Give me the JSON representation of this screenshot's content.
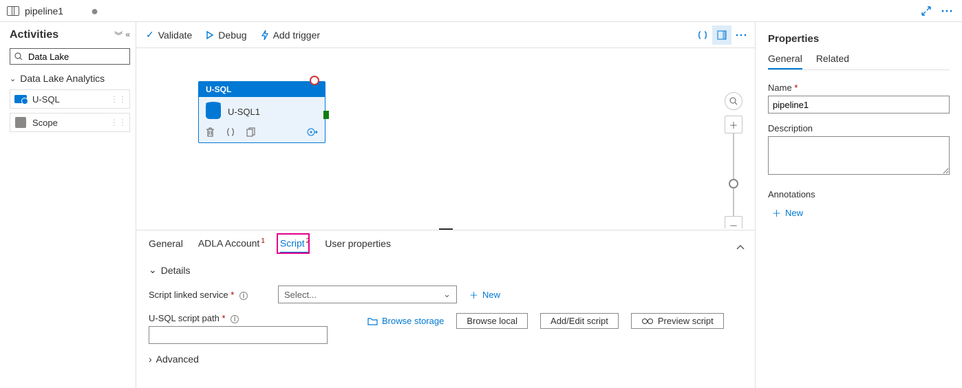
{
  "topbar": {
    "file_title": "pipeline1",
    "dirty": "●"
  },
  "sidebar": {
    "title": "Activities",
    "search_value": "Data Lake",
    "category": "Data Lake Analytics",
    "items": [
      {
        "label": "U-SQL"
      },
      {
        "label": "Scope"
      }
    ]
  },
  "toolbar": {
    "validate": "Validate",
    "debug": "Debug",
    "add_trigger": "Add trigger"
  },
  "node": {
    "type": "U-SQL",
    "name": "U-SQL1"
  },
  "bottom_tabs": {
    "general": "General",
    "adla": "ADLA Account",
    "adla_badge": "1",
    "script": "Script",
    "script_badge": "2",
    "user_props": "User properties"
  },
  "form": {
    "details": "Details",
    "linked_label": "Script linked service",
    "select_placeholder": "Select...",
    "new_link": "New",
    "path_label": "U-SQL script path",
    "browse_storage": "Browse storage",
    "browse_local": "Browse local",
    "add_edit": "Add/Edit script",
    "preview": "Preview script",
    "advanced": "Advanced"
  },
  "props": {
    "title": "Properties",
    "tab_general": "General",
    "tab_related": "Related",
    "name_label": "Name",
    "name_value": "pipeline1",
    "desc_label": "Description",
    "desc_value": "",
    "annotations": "Annotations",
    "new": "New"
  }
}
